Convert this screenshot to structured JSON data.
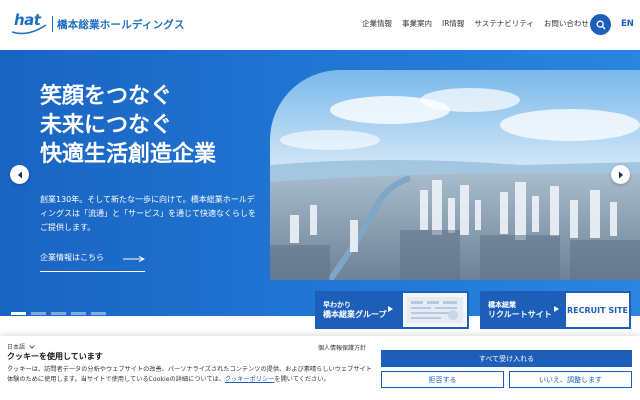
{
  "header": {
    "logo_mark_text": "hat",
    "company_name": "橋本総業ホールディングス",
    "nav": [
      {
        "label": "企業情報"
      },
      {
        "label": "事業案内"
      },
      {
        "label": "IR情報"
      },
      {
        "label": "サステナビリティ"
      },
      {
        "label": "お問い合わせ"
      }
    ],
    "search_icon": "search-icon",
    "lang_label": "EN"
  },
  "hero": {
    "headline_lines": [
      "笑顔をつなぐ",
      "未来につなぐ",
      "快適生活創造企業"
    ],
    "description": "創業130年。そして新たな一歩に向けて。橋本総業ホールディングスは「流通」と「サービス」を通じて快適なくらしをご提供します。",
    "link_label": "企業情報はこちら",
    "prev_icon": "chevron-left-icon",
    "next_icon": "chevron-right-icon",
    "slide_count": 5,
    "active_slide": 1
  },
  "banners": {
    "group": {
      "line1": "早わかり",
      "line2": "橋本総業グループ"
    },
    "recruit": {
      "line1": "橋本総業",
      "line2": "リクルートサイト",
      "badge": "RECRUIT SITE"
    }
  },
  "cookie": {
    "lang": "日本語",
    "title": "クッキーを使用しています",
    "body_text": "クッキーは、訪問者データの分析やウェブサイトの改善、パーソナライズされたコンテンツの提供、および素晴らしいウェブサイト体験のために使用します。当サイトで使用しているCookieの詳細については、",
    "policy_link": "クッキーポリシー",
    "body_suffix": "を開いてください。",
    "privacy_link": "個人情報保護方針",
    "accept_label": "すべて受け入れる",
    "reject_label": "拒否する",
    "adjust_label": "いいえ、調整します"
  },
  "colors": {
    "brand": "#1d5fb8",
    "hero_bg": "#2074d2"
  }
}
